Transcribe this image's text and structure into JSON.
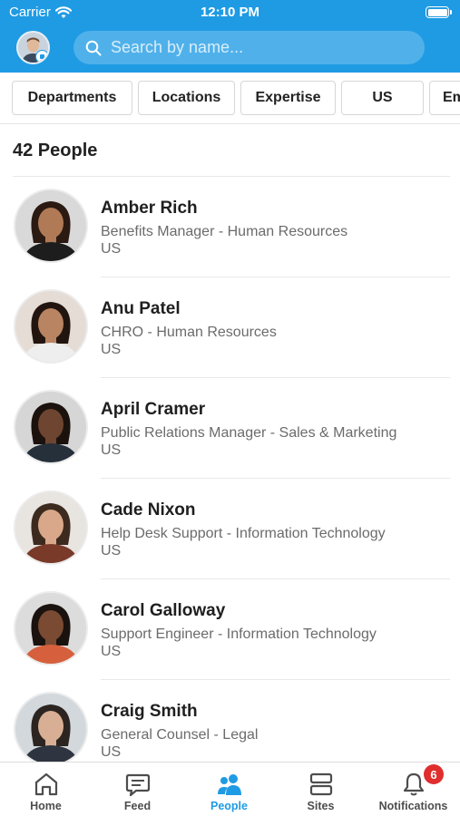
{
  "status_bar": {
    "carrier": "Carrier",
    "time": "12:10 PM"
  },
  "search": {
    "placeholder": "Search by name..."
  },
  "filters": [
    "Departments",
    "Locations",
    "Expertise",
    "US",
    "Em"
  ],
  "people_count": "42 People",
  "people": [
    {
      "name": "Amber Rich",
      "role": "Benefits Manager - Human Resources",
      "location": "US",
      "skin": "#b07a56",
      "hair": "#2a1a12",
      "shirt": "#1d1d1d",
      "bg": "#d9d9d9"
    },
    {
      "name": "Anu Patel",
      "role": "CHRO - Human Resources",
      "location": "US",
      "skin": "#b98462",
      "hair": "#221510",
      "shirt": "#eeeeee",
      "bg": "#e5dcd6"
    },
    {
      "name": "April Cramer",
      "role": "Public Relations Manager - Sales & Marketing",
      "location": "US",
      "skin": "#6e4530",
      "hair": "#1b120d",
      "shirt": "#25303a",
      "bg": "#d6d6d6"
    },
    {
      "name": "Cade Nixon",
      "role": "Help Desk Support - Information Technology",
      "location": "US",
      "skin": "#d9a88a",
      "hair": "#3d2a1e",
      "shirt": "#7a3a2a",
      "bg": "#e8e4e0"
    },
    {
      "name": "Carol Galloway",
      "role": "Support Engineer - Information Technology",
      "location": "US",
      "skin": "#7a4a32",
      "hair": "#1a120e",
      "shirt": "#d6603d",
      "bg": "#dcdcdc"
    },
    {
      "name": "Craig Smith",
      "role": "General Counsel - Legal",
      "location": "US",
      "skin": "#d8ae94",
      "hair": "#2b2420",
      "shirt": "#2e3440",
      "bg": "#d2d8dc"
    }
  ],
  "tabs": [
    {
      "label": "Home",
      "icon": "home-icon"
    },
    {
      "label": "Feed",
      "icon": "feed-icon"
    },
    {
      "label": "People",
      "icon": "people-icon"
    },
    {
      "label": "Sites",
      "icon": "sites-icon"
    },
    {
      "label": "Notifications",
      "icon": "bell-icon"
    }
  ],
  "active_tab": "People",
  "notifications_badge": "6",
  "colors": {
    "accent": "#1f9be4",
    "badge": "#e02e2e"
  }
}
